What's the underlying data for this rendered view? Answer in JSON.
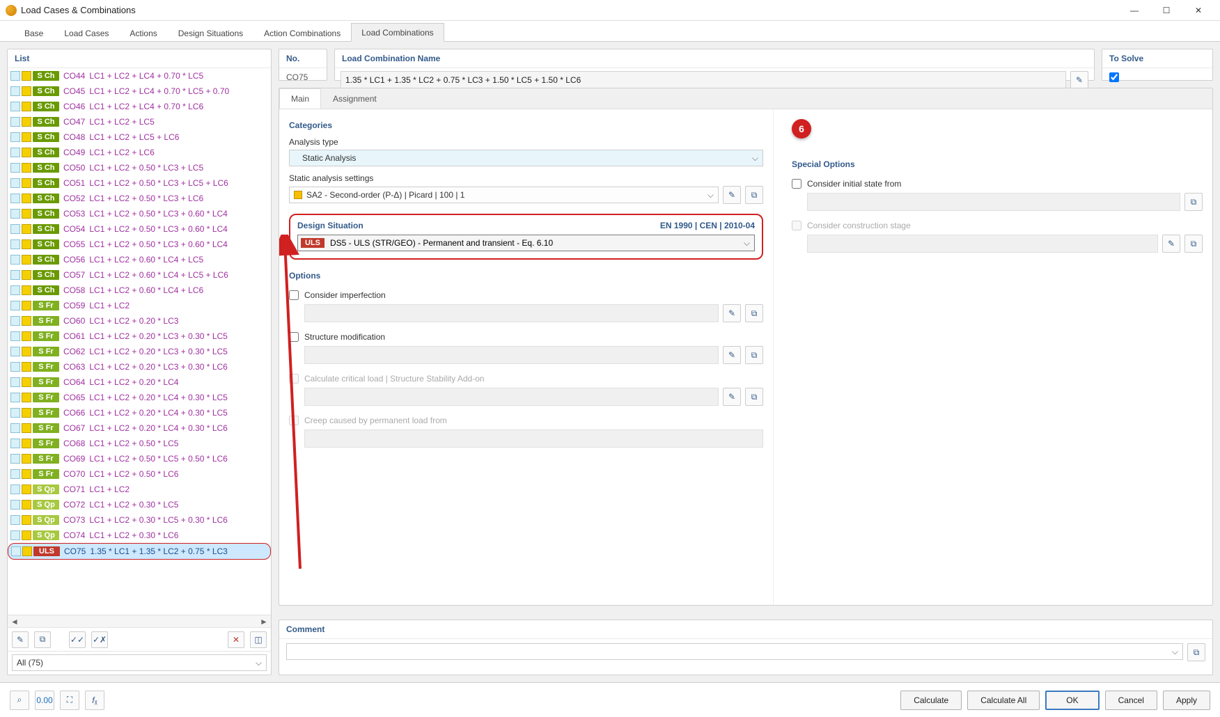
{
  "window": {
    "title": "Load Cases & Combinations"
  },
  "tabs": [
    "Base",
    "Load Cases",
    "Actions",
    "Design Situations",
    "Action Combinations",
    "Load Combinations"
  ],
  "tabs_active": 5,
  "list": {
    "header": "List",
    "items": [
      {
        "badge": "S Ch",
        "cls": "sch",
        "code": "CO44",
        "descr": "LC1 + LC2 + LC4 + 0.70 * LC5"
      },
      {
        "badge": "S Ch",
        "cls": "sch",
        "code": "CO45",
        "descr": "LC1 + LC2 + LC4 + 0.70 * LC5 + 0.70"
      },
      {
        "badge": "S Ch",
        "cls": "sch",
        "code": "CO46",
        "descr": "LC1 + LC2 + LC4 + 0.70 * LC6"
      },
      {
        "badge": "S Ch",
        "cls": "sch",
        "code": "CO47",
        "descr": "LC1 + LC2 + LC5"
      },
      {
        "badge": "S Ch",
        "cls": "sch",
        "code": "CO48",
        "descr": "LC1 + LC2 + LC5 + LC6"
      },
      {
        "badge": "S Ch",
        "cls": "sch",
        "code": "CO49",
        "descr": "LC1 + LC2 + LC6"
      },
      {
        "badge": "S Ch",
        "cls": "sch",
        "code": "CO50",
        "descr": "LC1 + LC2 + 0.50 * LC3 + LC5"
      },
      {
        "badge": "S Ch",
        "cls": "sch",
        "code": "CO51",
        "descr": "LC1 + LC2 + 0.50 * LC3 + LC5 + LC6"
      },
      {
        "badge": "S Ch",
        "cls": "sch",
        "code": "CO52",
        "descr": "LC1 + LC2 + 0.50 * LC3 + LC6"
      },
      {
        "badge": "S Ch",
        "cls": "sch",
        "code": "CO53",
        "descr": "LC1 + LC2 + 0.50 * LC3 + 0.60 * LC4"
      },
      {
        "badge": "S Ch",
        "cls": "sch",
        "code": "CO54",
        "descr": "LC1 + LC2 + 0.50 * LC3 + 0.60 * LC4"
      },
      {
        "badge": "S Ch",
        "cls": "sch",
        "code": "CO55",
        "descr": "LC1 + LC2 + 0.50 * LC3 + 0.60 * LC4"
      },
      {
        "badge": "S Ch",
        "cls": "sch",
        "code": "CO56",
        "descr": "LC1 + LC2 + 0.60 * LC4 + LC5"
      },
      {
        "badge": "S Ch",
        "cls": "sch",
        "code": "CO57",
        "descr": "LC1 + LC2 + 0.60 * LC4 + LC5 + LC6"
      },
      {
        "badge": "S Ch",
        "cls": "sch",
        "code": "CO58",
        "descr": "LC1 + LC2 + 0.60 * LC4 + LC6"
      },
      {
        "badge": "S Fr",
        "cls": "sfr",
        "code": "CO59",
        "descr": "LC1 + LC2"
      },
      {
        "badge": "S Fr",
        "cls": "sfr",
        "code": "CO60",
        "descr": "LC1 + LC2 + 0.20 * LC3"
      },
      {
        "badge": "S Fr",
        "cls": "sfr",
        "code": "CO61",
        "descr": "LC1 + LC2 + 0.20 * LC3 + 0.30 * LC5"
      },
      {
        "badge": "S Fr",
        "cls": "sfr",
        "code": "CO62",
        "descr": "LC1 + LC2 + 0.20 * LC3 + 0.30 * LC5"
      },
      {
        "badge": "S Fr",
        "cls": "sfr",
        "code": "CO63",
        "descr": "LC1 + LC2 + 0.20 * LC3 + 0.30 * LC6"
      },
      {
        "badge": "S Fr",
        "cls": "sfr",
        "code": "CO64",
        "descr": "LC1 + LC2 + 0.20 * LC4"
      },
      {
        "badge": "S Fr",
        "cls": "sfr",
        "code": "CO65",
        "descr": "LC1 + LC2 + 0.20 * LC4 + 0.30 * LC5"
      },
      {
        "badge": "S Fr",
        "cls": "sfr",
        "code": "CO66",
        "descr": "LC1 + LC2 + 0.20 * LC4 + 0.30 * LC5"
      },
      {
        "badge": "S Fr",
        "cls": "sfr",
        "code": "CO67",
        "descr": "LC1 + LC2 + 0.20 * LC4 + 0.30 * LC6"
      },
      {
        "badge": "S Fr",
        "cls": "sfr",
        "code": "CO68",
        "descr": "LC1 + LC2 + 0.50 * LC5"
      },
      {
        "badge": "S Fr",
        "cls": "sfr",
        "code": "CO69",
        "descr": "LC1 + LC2 + 0.50 * LC5 + 0.50 * LC6"
      },
      {
        "badge": "S Fr",
        "cls": "sfr",
        "code": "CO70",
        "descr": "LC1 + LC2 + 0.50 * LC6"
      },
      {
        "badge": "S Qp",
        "cls": "sqp",
        "code": "CO71",
        "descr": "LC1 + LC2"
      },
      {
        "badge": "S Qp",
        "cls": "sqp",
        "code": "CO72",
        "descr": "LC1 + LC2 + 0.30 * LC5"
      },
      {
        "badge": "S Qp",
        "cls": "sqp",
        "code": "CO73",
        "descr": "LC1 + LC2 + 0.30 * LC5 + 0.30 * LC6"
      },
      {
        "badge": "S Qp",
        "cls": "sqp",
        "code": "CO74",
        "descr": "LC1 + LC2 + 0.30 * LC6"
      },
      {
        "badge": "ULS",
        "cls": "uls",
        "code": "CO75",
        "descr": "1.35 * LC1 + 1.35 * LC2 + 0.75 * LC3",
        "selected": true
      }
    ],
    "filter": "All (75)"
  },
  "header": {
    "no_label": "No.",
    "no_value": "CO75",
    "name_label": "Load Combination Name",
    "name_value": "1.35 * LC1 + 1.35 * LC2 + 0.75 * LC3 + 1.50 * LC5 + 1.50 * LC6",
    "solve_label": "To Solve",
    "solve_checked": true
  },
  "subtabs": [
    "Main",
    "Assignment"
  ],
  "subtabs_active": 0,
  "categories": {
    "title": "Categories",
    "analysis_type_label": "Analysis type",
    "analysis_type_value": "Static Analysis",
    "settings_label": "Static analysis settings",
    "settings_value": "SA2 - Second-order (P-Δ) | Picard | 100 | 1"
  },
  "design_situation": {
    "title": "Design Situation",
    "standard": "EN 1990 | CEN | 2010-04",
    "badge": "ULS",
    "value": "DS5 - ULS (STR/GEO) - Permanent and transient - Eq. 6.10",
    "callout": "6"
  },
  "options": {
    "title": "Options",
    "imperfection": "Consider imperfection",
    "struct_mod": "Structure modification",
    "critical": "Calculate critical load | Structure Stability Add-on",
    "creep": "Creep caused by permanent load from"
  },
  "special": {
    "title": "Special Options",
    "initial": "Consider initial state from",
    "stage": "Consider construction stage"
  },
  "comment": {
    "title": "Comment"
  },
  "footer": {
    "calculate": "Calculate",
    "calculate_all": "Calculate All",
    "ok": "OK",
    "cancel": "Cancel",
    "apply": "Apply"
  }
}
